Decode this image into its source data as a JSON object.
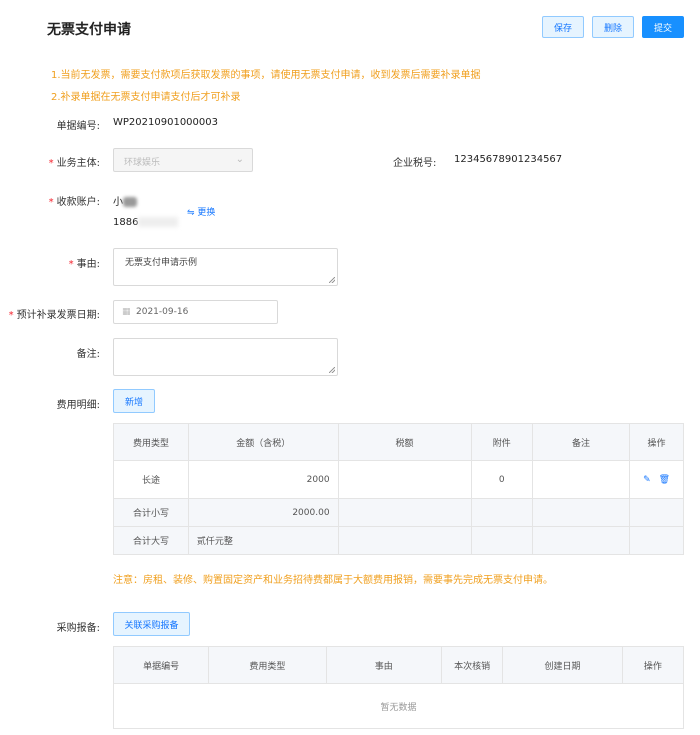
{
  "header": {
    "title": "无票支付申请",
    "save_label": "保存",
    "delete_label": "删除",
    "submit_label": "提交"
  },
  "notices": [
    "1.当前无发票，需要支付款项后获取发票的事项，请使用无票支付申请，收到发票后需要补录单据",
    "2.补录单据在无票支付申请支付后才可补录"
  ],
  "form": {
    "doc_no_label": "单据编号:",
    "doc_no": "WP20210901000003",
    "entity_label": "业务主体:",
    "entity_value": "环球娱乐",
    "tax_no_label": "企业税号:",
    "tax_no": "12345678901234567",
    "account_label": "收款账户:",
    "account_name": "小",
    "account_phone": "1886",
    "change_label": "更换",
    "reason_label": "事由:",
    "reason_value": "无票支付申请示例",
    "invoice_date_label": "预计补录发票日期:",
    "invoice_date_value": "2021-09-16",
    "remark_label": "备注:",
    "remark_value": ""
  },
  "expense": {
    "label": "费用明细:",
    "add_label": "新增",
    "columns": [
      "费用类型",
      "金额（含税）",
      "税额",
      "附件",
      "备注",
      "操作"
    ],
    "row": {
      "type": "长途",
      "amount": "2000",
      "tax": "",
      "attachments": "0",
      "remark": ""
    },
    "subtotal_label": "合计小写",
    "subtotal_value": "2000.00",
    "total_upper_label": "合计大写",
    "total_upper_value": "贰仟元整"
  },
  "warning": "注意：房租、装修、购置固定资产和业务招待费都属于大额费用报销，需要事先完成无票支付申请。",
  "purchase": {
    "label": "采购报备:",
    "link_label": "关联采购报备",
    "columns": [
      "单据编号",
      "费用类型",
      "事由",
      "本次核销",
      "创建日期",
      "操作"
    ],
    "empty_text": "暂无数据"
  },
  "colors": {
    "primary": "#1890ff",
    "warning": "#f0a020",
    "required": "#f5222d"
  }
}
